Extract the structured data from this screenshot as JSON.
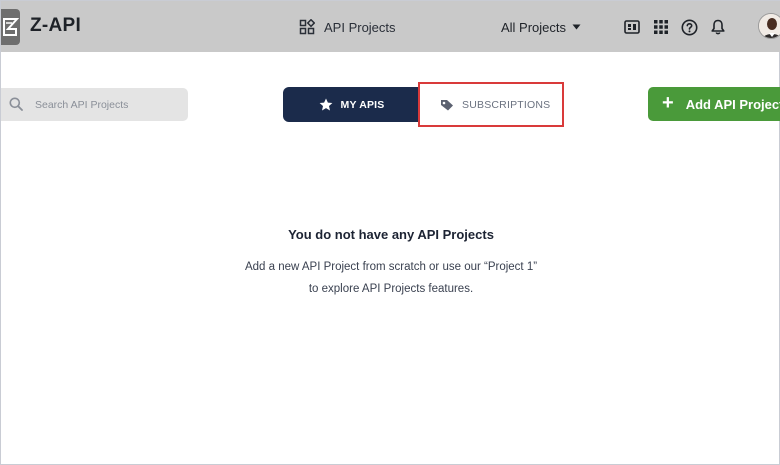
{
  "app": {
    "name": "Z-API"
  },
  "header": {
    "nav_projects_label": "API Projects",
    "filter_label": "All Projects"
  },
  "toolbar": {
    "search_placeholder": "Search API Projects",
    "tab_my_apis": "MY APIS",
    "tab_subscriptions": "SUBSCRIPTIONS",
    "add_button_label": "Add API Project"
  },
  "empty_state": {
    "title": "You do not have any API Projects",
    "line1": "Add a new API Project from scratch or use our “Project 1”",
    "line2": "to explore API Projects features."
  },
  "icons": {
    "header": [
      "grid-projects-icon",
      "caret-down-icon",
      "dashboard-icon",
      "apps-grid-icon",
      "help-icon",
      "bell-icon"
    ],
    "toolbar": [
      "search-icon",
      "star-icon",
      "tag-icon",
      "plus-icon"
    ]
  },
  "colors": {
    "topbar": "#c9c9c9",
    "primary_navy": "#1b2b4b",
    "add_green": "#4a9a3a",
    "highlight_red": "#d93a3a"
  }
}
